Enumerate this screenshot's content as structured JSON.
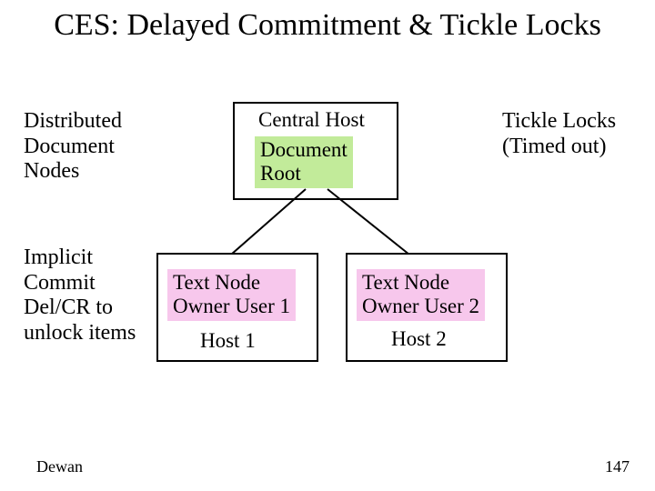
{
  "title": "CES: Delayed Commitment & Tickle Locks",
  "labels": {
    "distributed": "Distributed\nDocument\nNodes",
    "tickle": "Tickle Locks\n(Timed out)",
    "implicit": "Implicit\nCommit\nDel/CR to\nunlock items",
    "central_host": "Central Host",
    "host1": "Host 1",
    "host2": "Host 2"
  },
  "nodes": {
    "doc_root": "Document\nRoot",
    "text_node_1": "Text Node\nOwner User 1",
    "text_node_2": "Text Node\nOwner User 2"
  },
  "footer": {
    "author": "Dewan",
    "page": "147"
  }
}
